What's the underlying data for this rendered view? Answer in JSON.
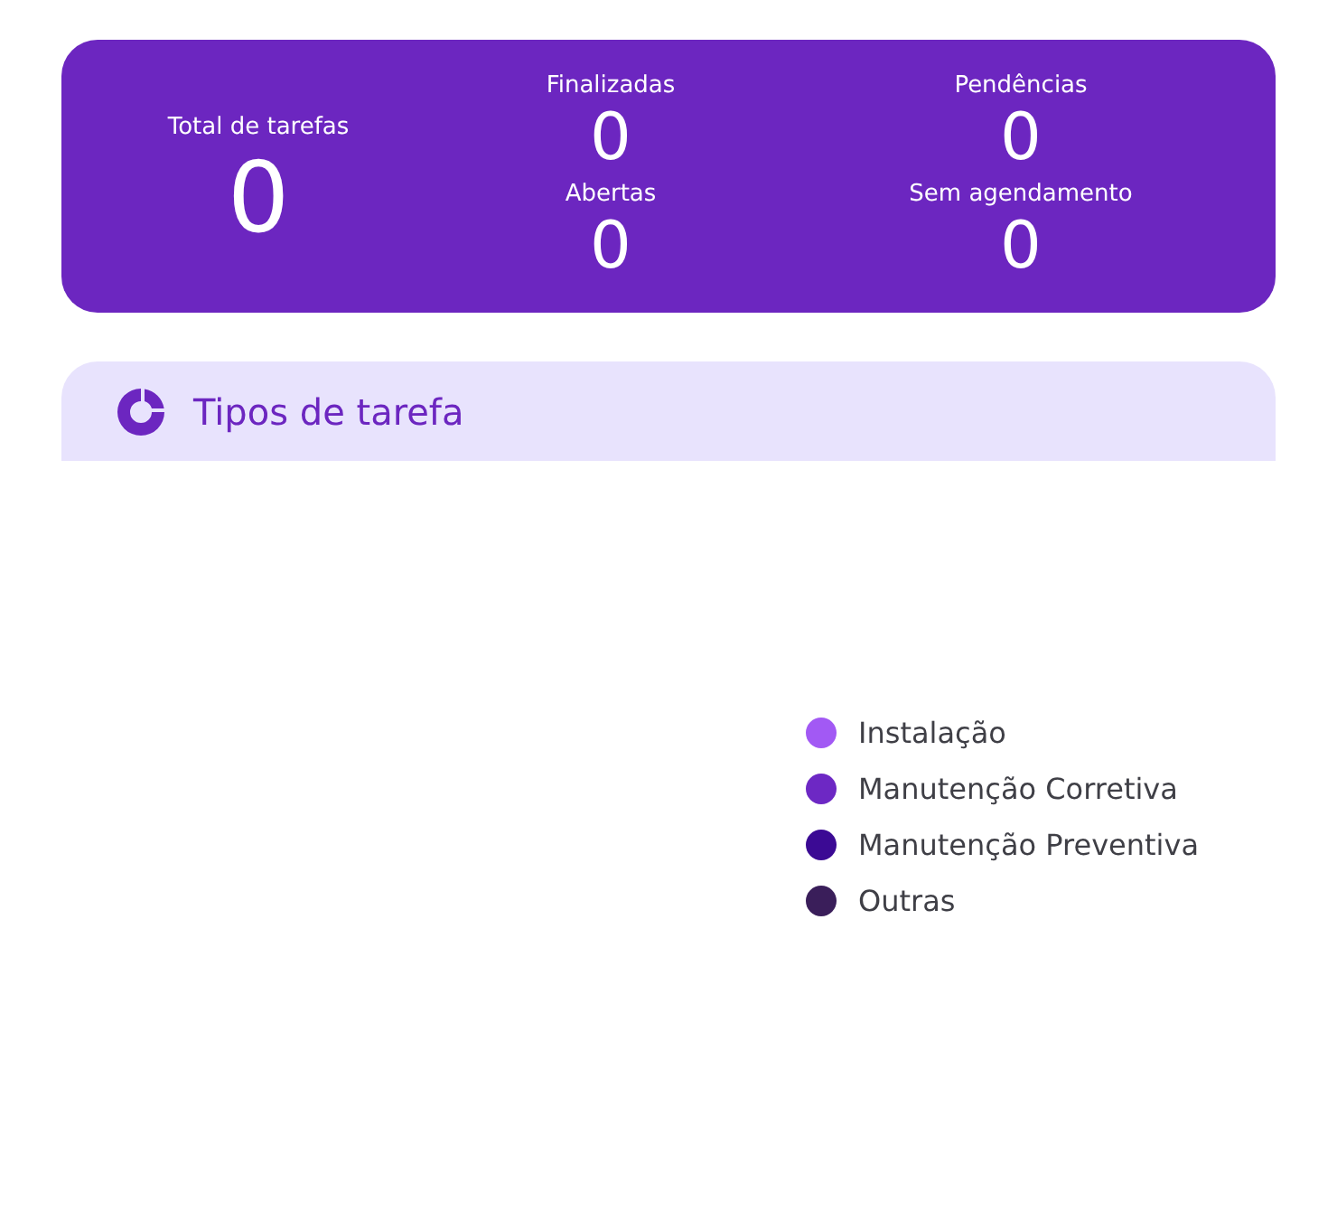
{
  "summary": {
    "total": {
      "label": "Total de tarefas",
      "value": "0"
    },
    "stats": [
      {
        "label": "Finalizadas",
        "value": "0"
      },
      {
        "label": "Pendências",
        "value": "0"
      },
      {
        "label": "Abertas",
        "value": "0"
      },
      {
        "label": "Sem agendamento",
        "value": "0"
      }
    ]
  },
  "task_types": {
    "title": "Tipos de tarefa",
    "legend": [
      {
        "label": "Instalação",
        "color": "#a259f4"
      },
      {
        "label": "Manutenção Corretiva",
        "color": "#6d28c4"
      },
      {
        "label": "Manutenção Preventiva",
        "color": "#3b0a94"
      },
      {
        "label": "Outras",
        "color": "#3a1e5a"
      }
    ]
  }
}
